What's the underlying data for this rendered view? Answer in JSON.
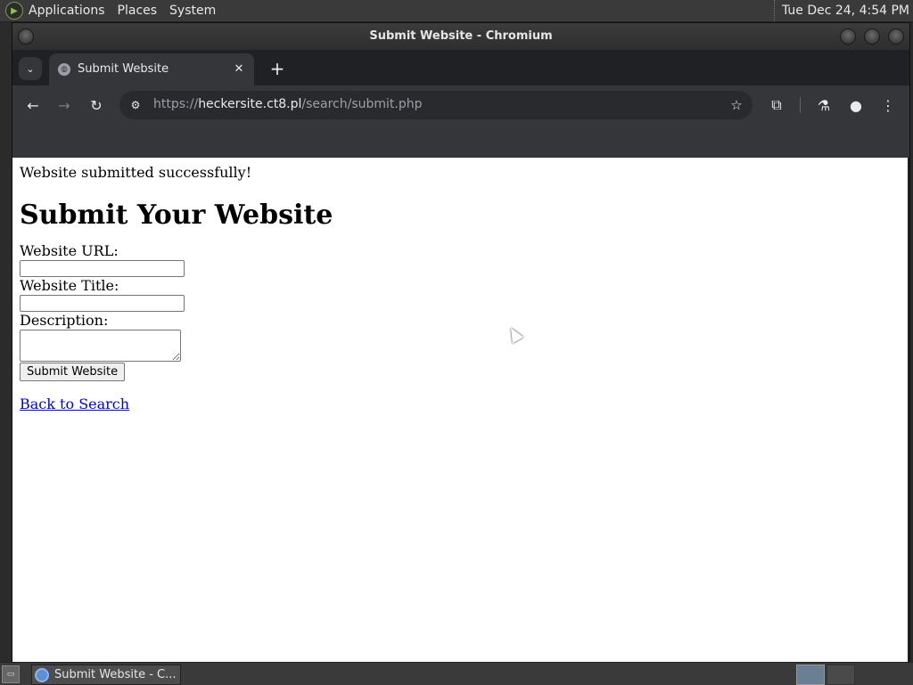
{
  "top_panel": {
    "menus": [
      "Applications",
      "Places",
      "System"
    ],
    "clock": "Tue Dec 24,  4:54 PM"
  },
  "window": {
    "title": "Submit Website - Chromium"
  },
  "tabs": [
    {
      "title": "Submit Website",
      "active": true
    }
  ],
  "omnibox": {
    "url_scheme": "https://",
    "url_host": "heckersite.ct8.pl",
    "url_path": "/search/submit.php"
  },
  "page": {
    "success_message": "Website submitted successfully!",
    "heading": "Submit Your Website",
    "form": {
      "url_label": "Website URL:",
      "url_value": "",
      "title_label": "Website Title:",
      "title_value": "",
      "description_label": "Description:",
      "description_value": "",
      "submit_label": "Submit Website"
    },
    "back_link": "Back to Search"
  },
  "taskbar": {
    "task_label": "Submit Website - C..."
  }
}
